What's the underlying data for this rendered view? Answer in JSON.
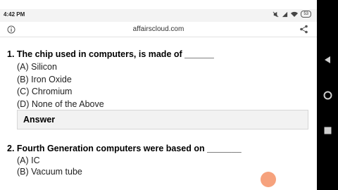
{
  "status": {
    "time": "4:42 PM",
    "battery": "53"
  },
  "browser": {
    "url": "affairscloud.com"
  },
  "questions": [
    {
      "title": "1. The chip used in computers, is made of ______",
      "options": [
        "(A) Silicon",
        "(B) Iron Oxide",
        "(C) Chromium",
        "(D) None of the Above"
      ],
      "answer_label": "Answer"
    },
    {
      "title": "2. Fourth Generation computers were based on _______",
      "options": [
        "(A) IC",
        "(B) Vacuum tube"
      ]
    }
  ]
}
